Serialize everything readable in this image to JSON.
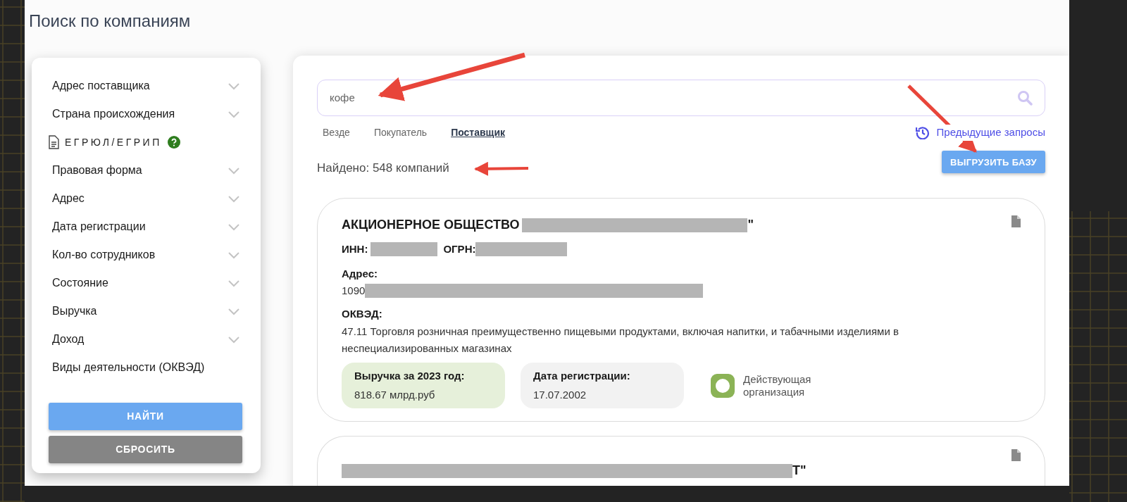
{
  "page": {
    "title": "Поиск по компаниям"
  },
  "filters": [
    {
      "kind": "dropdown",
      "label": "Адрес поставщика"
    },
    {
      "kind": "dropdown",
      "label": "Страна происхождения"
    },
    {
      "kind": "section",
      "label": "ЕГРЮЛ/ЕГРИП"
    },
    {
      "kind": "dropdown",
      "label": "Правовая форма"
    },
    {
      "kind": "dropdown",
      "label": "Адрес"
    },
    {
      "kind": "dropdown",
      "label": "Дата регистрации"
    },
    {
      "kind": "dropdown",
      "label": "Кол-во сотрудников"
    },
    {
      "kind": "dropdown",
      "label": "Состояние"
    },
    {
      "kind": "dropdown",
      "label": "Выручка"
    },
    {
      "kind": "dropdown",
      "label": "Доход"
    },
    {
      "kind": "plain",
      "label": "Виды деятельности (ОКВЭД)"
    }
  ],
  "filter_buttons": [
    {
      "kind": "primary",
      "label": "НАЙТИ"
    },
    {
      "kind": "secondary",
      "label": "СБРОСИТЬ"
    }
  ],
  "search": {
    "value": "кофе"
  },
  "scopes": [
    {
      "label": "Везде",
      "selected": false
    },
    {
      "label": "Покупатель",
      "selected": false
    },
    {
      "label": "Поставщик",
      "selected": true
    }
  ],
  "history_link": "Предыдущие запросы",
  "found": "Найдено: 548 компаний",
  "export_button": "ВЫГРУЗИТЬ БАЗУ",
  "cards": [
    {
      "kind": "full",
      "title_prefix": "АКЦИОНЕРНОЕ ОБЩЕСТВО",
      "title_suffix": "\"",
      "inn_label": "ИНН:",
      "ogrn_label": "ОГРН:",
      "address_label": "Адрес:",
      "address_start": "1090",
      "okved_label": "ОКВЭД:",
      "okved": "47.11 Торговля розничная преимущественно пищевыми продуктами, включая напитки, и табачными изделиями в неспециализированных магазинах",
      "revenue_label": "Выручка за 2023 год:",
      "revenue": "818.67 млрд.руб",
      "reg_label": "Дата регистрации:",
      "reg_date": "17.07.2002",
      "status": "Действующая организация",
      "active": true
    },
    {
      "kind": "clipped",
      "title_suffix": "Т\""
    }
  ]
}
